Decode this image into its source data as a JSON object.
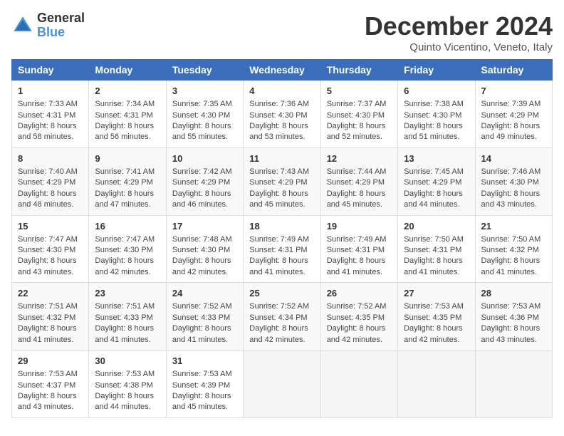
{
  "logo": {
    "general": "General",
    "blue": "Blue"
  },
  "title": "December 2024",
  "location": "Quinto Vicentino, Veneto, Italy",
  "days_of_week": [
    "Sunday",
    "Monday",
    "Tuesday",
    "Wednesday",
    "Thursday",
    "Friday",
    "Saturday"
  ],
  "weeks": [
    [
      {
        "day": "1",
        "sunrise": "7:33 AM",
        "sunset": "4:31 PM",
        "daylight": "8 hours and 58 minutes."
      },
      {
        "day": "2",
        "sunrise": "7:34 AM",
        "sunset": "4:31 PM",
        "daylight": "8 hours and 56 minutes."
      },
      {
        "day": "3",
        "sunrise": "7:35 AM",
        "sunset": "4:30 PM",
        "daylight": "8 hours and 55 minutes."
      },
      {
        "day": "4",
        "sunrise": "7:36 AM",
        "sunset": "4:30 PM",
        "daylight": "8 hours and 53 minutes."
      },
      {
        "day": "5",
        "sunrise": "7:37 AM",
        "sunset": "4:30 PM",
        "daylight": "8 hours and 52 minutes."
      },
      {
        "day": "6",
        "sunrise": "7:38 AM",
        "sunset": "4:30 PM",
        "daylight": "8 hours and 51 minutes."
      },
      {
        "day": "7",
        "sunrise": "7:39 AM",
        "sunset": "4:29 PM",
        "daylight": "8 hours and 49 minutes."
      }
    ],
    [
      {
        "day": "8",
        "sunrise": "7:40 AM",
        "sunset": "4:29 PM",
        "daylight": "8 hours and 48 minutes."
      },
      {
        "day": "9",
        "sunrise": "7:41 AM",
        "sunset": "4:29 PM",
        "daylight": "8 hours and 47 minutes."
      },
      {
        "day": "10",
        "sunrise": "7:42 AM",
        "sunset": "4:29 PM",
        "daylight": "8 hours and 46 minutes."
      },
      {
        "day": "11",
        "sunrise": "7:43 AM",
        "sunset": "4:29 PM",
        "daylight": "8 hours and 45 minutes."
      },
      {
        "day": "12",
        "sunrise": "7:44 AM",
        "sunset": "4:29 PM",
        "daylight": "8 hours and 45 minutes."
      },
      {
        "day": "13",
        "sunrise": "7:45 AM",
        "sunset": "4:29 PM",
        "daylight": "8 hours and 44 minutes."
      },
      {
        "day": "14",
        "sunrise": "7:46 AM",
        "sunset": "4:30 PM",
        "daylight": "8 hours and 43 minutes."
      }
    ],
    [
      {
        "day": "15",
        "sunrise": "7:47 AM",
        "sunset": "4:30 PM",
        "daylight": "8 hours and 43 minutes."
      },
      {
        "day": "16",
        "sunrise": "7:47 AM",
        "sunset": "4:30 PM",
        "daylight": "8 hours and 42 minutes."
      },
      {
        "day": "17",
        "sunrise": "7:48 AM",
        "sunset": "4:30 PM",
        "daylight": "8 hours and 42 minutes."
      },
      {
        "day": "18",
        "sunrise": "7:49 AM",
        "sunset": "4:31 PM",
        "daylight": "8 hours and 41 minutes."
      },
      {
        "day": "19",
        "sunrise": "7:49 AM",
        "sunset": "4:31 PM",
        "daylight": "8 hours and 41 minutes."
      },
      {
        "day": "20",
        "sunrise": "7:50 AM",
        "sunset": "4:31 PM",
        "daylight": "8 hours and 41 minutes."
      },
      {
        "day": "21",
        "sunrise": "7:50 AM",
        "sunset": "4:32 PM",
        "daylight": "8 hours and 41 minutes."
      }
    ],
    [
      {
        "day": "22",
        "sunrise": "7:51 AM",
        "sunset": "4:32 PM",
        "daylight": "8 hours and 41 minutes."
      },
      {
        "day": "23",
        "sunrise": "7:51 AM",
        "sunset": "4:33 PM",
        "daylight": "8 hours and 41 minutes."
      },
      {
        "day": "24",
        "sunrise": "7:52 AM",
        "sunset": "4:33 PM",
        "daylight": "8 hours and 41 minutes."
      },
      {
        "day": "25",
        "sunrise": "7:52 AM",
        "sunset": "4:34 PM",
        "daylight": "8 hours and 42 minutes."
      },
      {
        "day": "26",
        "sunrise": "7:52 AM",
        "sunset": "4:35 PM",
        "daylight": "8 hours and 42 minutes."
      },
      {
        "day": "27",
        "sunrise": "7:53 AM",
        "sunset": "4:35 PM",
        "daylight": "8 hours and 42 minutes."
      },
      {
        "day": "28",
        "sunrise": "7:53 AM",
        "sunset": "4:36 PM",
        "daylight": "8 hours and 43 minutes."
      }
    ],
    [
      {
        "day": "29",
        "sunrise": "7:53 AM",
        "sunset": "4:37 PM",
        "daylight": "8 hours and 43 minutes."
      },
      {
        "day": "30",
        "sunrise": "7:53 AM",
        "sunset": "4:38 PM",
        "daylight": "8 hours and 44 minutes."
      },
      {
        "day": "31",
        "sunrise": "7:53 AM",
        "sunset": "4:39 PM",
        "daylight": "8 hours and 45 minutes."
      },
      null,
      null,
      null,
      null
    ]
  ]
}
